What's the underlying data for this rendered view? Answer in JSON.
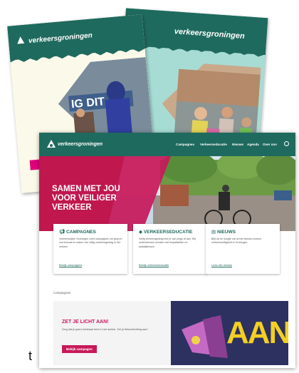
{
  "brochure_front": {
    "logo": "verkeersgroningen"
  },
  "brochure_back": {
    "logo": "verkeersgroningen"
  },
  "website": {
    "logo": "verkeersgroningen",
    "nav": [
      "Campagnes",
      "Verkeerseducatie",
      "Nieuws",
      "Agenda",
      "Over ons"
    ],
    "hero_title_1": "SAMEN MET JOU",
    "hero_title_2": "VOOR VEILIGER",
    "hero_title_3": "VERKEER",
    "cards": [
      {
        "title": "CAMPAGNES",
        "body": "Verkeerswijzer Groningen voert campagnes om jong en oud bewust te maken van veilig verkeersgedrag in het verkeer.",
        "link": "Bekijk campagnes"
      },
      {
        "title": "VERKEERSEDUCATIE",
        "body": "Veilig verkeersgedrag leer je van jongs af aan. Wij ondersteunen scholen met lespakketten en praktijklessen.",
        "link": "Bekijk verkeerseducatie"
      },
      {
        "title": "NIEUWS",
        "body": "Blijf op de hoogte van al het nieuws rondom verkeersveiligheid in Groningen.",
        "link": "Lees het nieuws"
      }
    ],
    "section_label": "Campagnes",
    "campaign_title": "ZET JE LICHT AAN!",
    "campaign_body": "Zorg dat je goed zichtbaar bent in het donker. Zet je fietsverlichting aan!",
    "campaign_button": "Bekijk campagne",
    "poster_text": "AAN"
  },
  "left_fragment": "t",
  "colors": {
    "teal": "#1f6a5e",
    "magenta": "#c7195a",
    "mint": "#a7dcd4",
    "cream": "#fbf9ea"
  }
}
